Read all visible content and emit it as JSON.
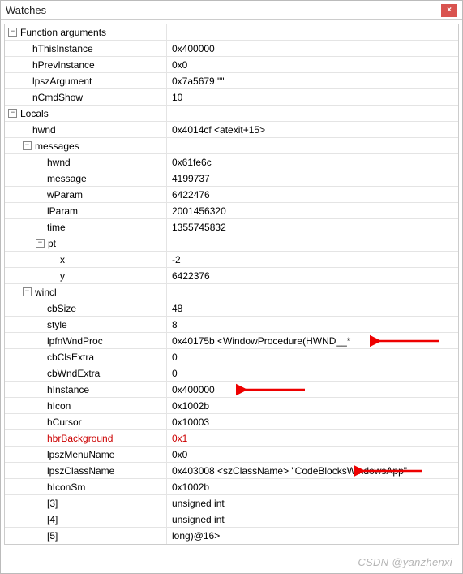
{
  "title": "Watches",
  "close": "×",
  "rows": [
    {
      "indent": 0,
      "toggle": "−",
      "name": "Function arguments",
      "value": ""
    },
    {
      "indent": 1,
      "name": "hThisInstance",
      "value": "0x400000"
    },
    {
      "indent": 1,
      "name": "hPrevInstance",
      "value": "0x0"
    },
    {
      "indent": 1,
      "name": "lpszArgument",
      "value": "0x7a5679 \"\""
    },
    {
      "indent": 1,
      "name": "nCmdShow",
      "value": "10"
    },
    {
      "indent": 0,
      "toggle": "−",
      "name": "Locals",
      "value": ""
    },
    {
      "indent": 1,
      "name": "hwnd",
      "value": "0x4014cf <atexit+15>"
    },
    {
      "indent": 1,
      "toggle": "−",
      "name": "messages",
      "value": ""
    },
    {
      "indent": 2,
      "name": "hwnd",
      "value": "0x61fe6c"
    },
    {
      "indent": 2,
      "name": "message",
      "value": "4199737"
    },
    {
      "indent": 2,
      "name": "wParam",
      "value": "6422476"
    },
    {
      "indent": 2,
      "name": "lParam",
      "value": "2001456320"
    },
    {
      "indent": 2,
      "name": "time",
      "value": "1355745832"
    },
    {
      "indent": 2,
      "toggle": "−",
      "name": "pt",
      "value": ""
    },
    {
      "indent": 3,
      "name": "x",
      "value": "-2"
    },
    {
      "indent": 3,
      "name": "y",
      "value": "6422376"
    },
    {
      "indent": 1,
      "toggle": "−",
      "name": "wincl",
      "value": ""
    },
    {
      "indent": 2,
      "name": "cbSize",
      "value": "48"
    },
    {
      "indent": 2,
      "name": "style",
      "value": "8"
    },
    {
      "indent": 2,
      "name": "lpfnWndProc",
      "value": "0x40175b <WindowProcedure(HWND__*",
      "arrow": 1
    },
    {
      "indent": 2,
      "name": "cbClsExtra",
      "value": "0"
    },
    {
      "indent": 2,
      "name": "cbWndExtra",
      "value": "0"
    },
    {
      "indent": 2,
      "name": "hInstance",
      "value": "0x400000",
      "arrow": 2
    },
    {
      "indent": 2,
      "name": "hIcon",
      "value": "0x1002b"
    },
    {
      "indent": 2,
      "name": "hCursor",
      "value": "0x10003"
    },
    {
      "indent": 2,
      "name": "hbrBackground",
      "value": "0x1",
      "red": true
    },
    {
      "indent": 2,
      "name": "lpszMenuName",
      "value": "0x0"
    },
    {
      "indent": 2,
      "name": "lpszClassName",
      "value": "0x403008 <szClassName> \"CodeBlocksWindowsApp\"",
      "arrow": 3
    },
    {
      "indent": 2,
      "name": "hIconSm",
      "value": "0x1002b"
    },
    {
      "indent": 2,
      "name": "[3]",
      "value": "unsigned int"
    },
    {
      "indent": 2,
      "name": "[4]",
      "value": "unsigned int"
    },
    {
      "indent": 2,
      "name": "[5]",
      "value": "long)@16>"
    }
  ],
  "watermark": "CSDN @yanzhenxi"
}
